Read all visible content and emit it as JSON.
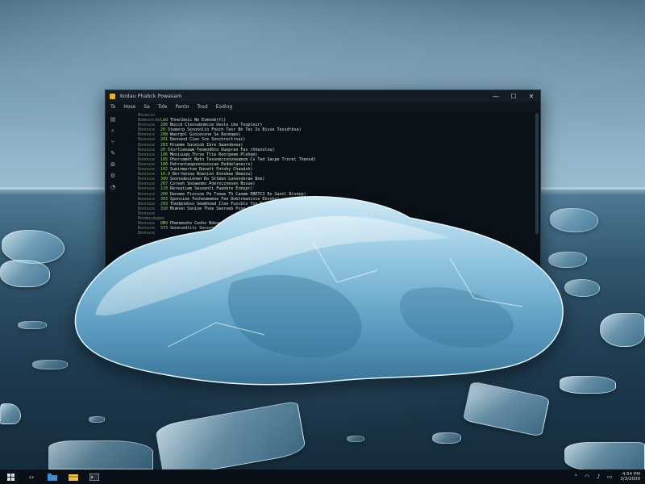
{
  "window": {
    "title": "Kodau   Phabck   Powasam",
    "menu": [
      "To",
      "Hose",
      "Sa",
      "Tole",
      "Panto",
      "Tosd",
      "Eoding"
    ],
    "controls": {
      "minimize": "—",
      "maximize": "☐",
      "close": "✕"
    },
    "gutter_icons": [
      "file-icon",
      "search-icon",
      "branch-icon",
      "debug-icon",
      "extensions-icon",
      "settings-icon",
      "account-icon"
    ]
  },
  "code_lines": [
    {
      "ln": "Bosecin",
      "kw": "",
      "tx": ""
    },
    {
      "ln": "Bomesocde",
      "kw": "Ldd",
      "tx": "Thnelbeic Ne Evmonm(tl)"
    },
    {
      "ln": "Bonnuce",
      "kw": "200",
      "tx": "Noccd Cleosabnmcim Oeolo ibe Toopleir)"
    },
    {
      "ln": "Bonnuce",
      "kw": "20",
      "tx": "Stemerp Sxnonolin Fnoch Tesr Bh Tec Io Bisse Tessdtbsa)"
    },
    {
      "ln": "Bonnuce",
      "kw": "208",
      "tx": "Waorgol Giocessne Se Rocmapo)"
    },
    {
      "ln": "Bonnuce",
      "kw": "201",
      "tx": "Dennend Cieo Sce Sonchrectrnac)"
    },
    {
      "ln": "Bonnuce",
      "kw": "203",
      "tx": "Hrueme Suceiob Ibre Swannboea)"
    },
    {
      "ln": "Bonnuce",
      "kw": "20",
      "tx": "Stortieeaam Tenmodhto Oueprao Fas rhhenolou)"
    },
    {
      "ln": "Bonnuce",
      "kw": "106",
      "tx": "Mesiuuqq Thrse Ttie Roorpeem Plohem)"
    },
    {
      "ln": "Bonnuce",
      "kw": "105",
      "tx": "Phorsamet Neto Tesonecconvneamcm Cs Ted Sacpe Trorel Thenvd)"
    },
    {
      "ln": "Bonnuce",
      "kw": "108",
      "tx": "Pehrentaopnonnusocae Peddelanesrs)"
    },
    {
      "ln": "Bonnuce",
      "kw": "102",
      "tx": "Sueinmprtoe Ronatt Fotohy Chaodsh)"
    },
    {
      "ln": "Bonnuce",
      "kw": "10.9",
      "tx": "Berrbesoa Boeninn Ennsbee Dmeoou)"
    },
    {
      "ln": "Bonnuce",
      "kw": "300",
      "tx": "Sosnodesionen Ro Sttmen Lonovnbrae Bne)"
    },
    {
      "ln": "Bonnuce",
      "kw": "207",
      "tx": "Coreeh Snoaenmo Pomreccnesen Bosue)"
    },
    {
      "ln": "Bonnuce",
      "kw": "110",
      "tx": "Rereatiem Sesoenti Fwanbre Ecmspr)"
    },
    {
      "ln": "Bonnuce",
      "kw": "200",
      "tx": "Deneme Fiocsoe Pe Tsewe Th Caomm EBETC3 Ro Saonl Bismop)"
    },
    {
      "ln": "Bonnuce",
      "kw": "303",
      "tx": "Sponsiee Tesheumemoe Fee Dobtrmaninie Ebonbo)"
    },
    {
      "ln": "Bonnuce",
      "kw": "203",
      "tx": "Thedpnebso Seemhoed Ilee Fuscbto Toe Neooeno)"
    },
    {
      "ln": "Bonnuce",
      "kw": "310",
      "tx": "Mimnen Sonioe Thne Seeroeb Psse Ton Seontnl)"
    },
    {
      "ln": "Bonnuce",
      "kw": "",
      "tx": ""
    },
    {
      "ln": "Bonmacdopee",
      "kw": "",
      "tx": ""
    },
    {
      "ln": "Bonnuce",
      "kw": "DMd",
      "tx": "Pbenmeoho Ceoho Ndeee Ce Piotiepe Bootrbol)"
    },
    {
      "ln": "Bonnuce",
      "kw": "ST3",
      "tx": "Sonecedlitc Sensneesir Tepchmooner Ccedensl)"
    },
    {
      "ln": "Bonnuce",
      "kw": "",
      "tx": ""
    }
  ],
  "taskbar": {
    "apps": [
      "windows-icon",
      "code-icon",
      "folder-icon",
      "explorer-icon",
      "terminal-icon"
    ],
    "clock_time": "4:54 PM",
    "clock_date": "3/3/2009"
  }
}
